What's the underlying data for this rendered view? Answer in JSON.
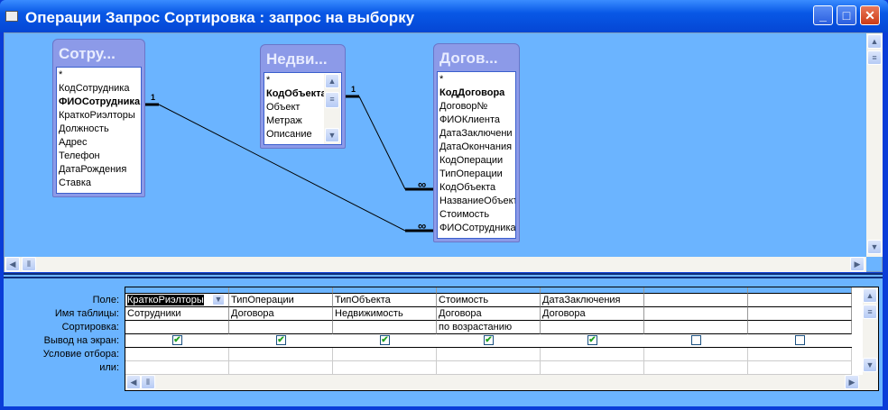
{
  "window": {
    "title": "Операции Запрос Сортировка : запрос на выборку",
    "min": "_",
    "max": "□",
    "close": "✕"
  },
  "tables": [
    {
      "title": "Сотру...",
      "fields": [
        {
          "name": "*"
        },
        {
          "name": "КодСотрудника"
        },
        {
          "name": "ФИОСотрудника",
          "key": true
        },
        {
          "name": "КраткоРиэлторы"
        },
        {
          "name": "Должность"
        },
        {
          "name": "Адрес"
        },
        {
          "name": "Телефон"
        },
        {
          "name": "ДатаРождения"
        },
        {
          "name": "Ставка"
        }
      ]
    },
    {
      "title": "Недви...",
      "fields": [
        {
          "name": "*"
        },
        {
          "name": "КодОбъекта",
          "key": true
        },
        {
          "name": "Объект"
        },
        {
          "name": "Метраж"
        },
        {
          "name": "Описание"
        }
      ]
    },
    {
      "title": "Догов...",
      "fields": [
        {
          "name": "*"
        },
        {
          "name": "КодДоговора",
          "key": true
        },
        {
          "name": "Договор№"
        },
        {
          "name": "ФИОКлиента"
        },
        {
          "name": "ДатаЗаключени"
        },
        {
          "name": "ДатаОкончания"
        },
        {
          "name": "КодОперации"
        },
        {
          "name": "ТипОперации"
        },
        {
          "name": "КодОбъекта"
        },
        {
          "name": "НазваниеОбъекта"
        },
        {
          "name": "Стоимость"
        },
        {
          "name": "ФИОСотрудника"
        }
      ]
    }
  ],
  "relations": {
    "one": "1",
    "many": "∞"
  },
  "grid": {
    "row_labels": [
      "Поле:",
      "Имя таблицы:",
      "Сортировка:",
      "Вывод на экран:",
      "Условие отбора:",
      "или:"
    ],
    "columns": [
      {
        "field": "КраткоРиэлторы",
        "table": "Сотрудники",
        "sort": "",
        "show": true
      },
      {
        "field": "ТипОперации",
        "table": "Договора",
        "sort": "",
        "show": true
      },
      {
        "field": "ТипОбъекта",
        "table": "Недвижимость",
        "sort": "",
        "show": true
      },
      {
        "field": "Стоимость",
        "table": "Договора",
        "sort": "по возрастанию",
        "show": true
      },
      {
        "field": "ДатаЗаключения",
        "table": "Договора",
        "sort": "",
        "show": true
      },
      {
        "field": "",
        "table": "",
        "sort": "",
        "show": false
      },
      {
        "field": "",
        "table": "",
        "sort": "",
        "show": false
      }
    ]
  }
}
